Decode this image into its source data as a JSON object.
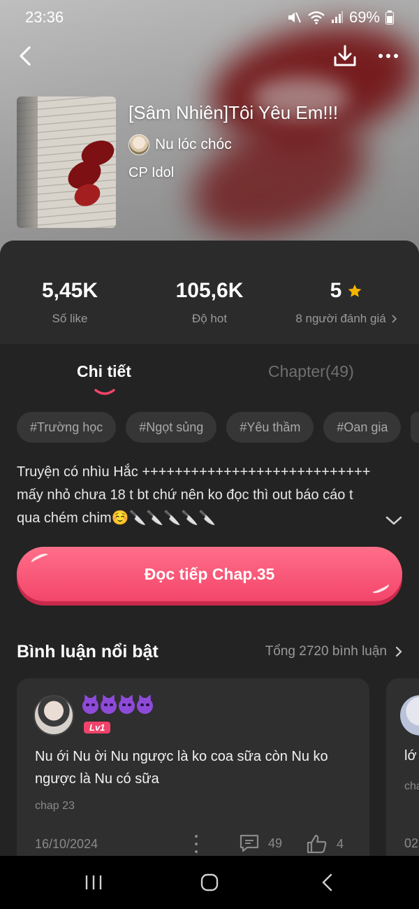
{
  "status_bar": {
    "time": "23:36",
    "battery": "69%"
  },
  "story": {
    "title": "[Sâm Nhiên]Tôi Yêu Em!!!",
    "author": "Nu lóc chóc",
    "category": "CP Idol"
  },
  "stats": {
    "likes": {
      "value": "5,45K",
      "label": "Số like"
    },
    "hot": {
      "value": "105,6K",
      "label": "Độ hot"
    },
    "rating": {
      "value": "5",
      "label": "8 người đánh giá"
    }
  },
  "tabs": [
    {
      "label": "Chi tiết",
      "active": true
    },
    {
      "label": "Chapter(49)",
      "active": false
    }
  ],
  "tags": [
    "#Trường học",
    "#Ngọt sủng",
    "#Yêu thầm",
    "#Oan gia"
  ],
  "description": "Truyện có nhìu Hắc ++++++++++++++++++++++++++++ mấy nhỏ chưa 18 t bt chứ nên ko đọc thì out báo cáo t qua chém chim☺️🔪🔪🔪🔪🔪",
  "read_button": "Đọc tiếp Chap.35",
  "comments_section": {
    "title": "Bình luận nổi bật",
    "total": "Tổng 2720 bình luận"
  },
  "comments": [
    {
      "level": "Lv1",
      "text": "Nu ới Nu ời Nu ngược là ko coa sữa còn Nu ko ngược là Nu có sữa",
      "chapter": "chap 23",
      "date": "16/10/2024",
      "reply_count": "49",
      "like_count": "4"
    },
    {
      "text": "lớ",
      "chapter": "cha",
      "date": "02"
    }
  ],
  "colors": {
    "accent": "#f3456a",
    "panel_bg": "#232323",
    "stats_bg": "#2b2b2b",
    "star": "#f5b400",
    "devil": "#8e4bd8"
  },
  "icons": [
    "back-arrow-icon",
    "download-icon",
    "more-icon",
    "star-icon",
    "chevron-right-icon",
    "chevron-down-icon",
    "comment-icon",
    "thumbs-up-icon",
    "menu-icon",
    "home-icon",
    "back-icon"
  ]
}
